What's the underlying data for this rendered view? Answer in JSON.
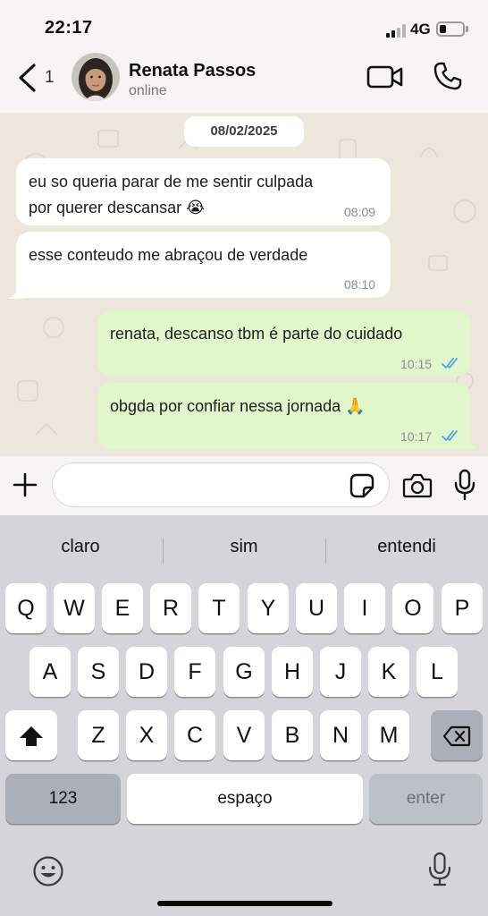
{
  "status_bar": {
    "time": "22:17",
    "network": "4G"
  },
  "header": {
    "unread_count": "1",
    "contact_name": "Renata Passos",
    "contact_status": "online"
  },
  "chat": {
    "date": "08/02/2025",
    "messages": [
      {
        "direction": "in",
        "lines": [
          "eu so queria parar de me sentir culpada",
          "por querer descansar 😭"
        ],
        "time": "08:09"
      },
      {
        "direction": "in",
        "lines": [
          "esse conteudo me abraçou de verdade"
        ],
        "time": "08:10"
      },
      {
        "direction": "out",
        "lines": [
          "renata, descanso tbm é parte do cuidado"
        ],
        "time": "10:15",
        "status": "read"
      },
      {
        "direction": "out",
        "lines": [
          "obgda por confiar nessa jornada 🙏"
        ],
        "time": "10:17",
        "status": "read"
      }
    ]
  },
  "composer": {
    "value": "",
    "placeholder": ""
  },
  "keyboard": {
    "suggestions": [
      "claro",
      "sim",
      "entendi"
    ],
    "row1": [
      "Q",
      "W",
      "E",
      "R",
      "T",
      "Y",
      "U",
      "I",
      "O",
      "P"
    ],
    "row2": [
      "A",
      "S",
      "D",
      "F",
      "G",
      "H",
      "J",
      "K",
      "L"
    ],
    "row3": [
      "Z",
      "X",
      "C",
      "V",
      "B",
      "N",
      "M"
    ],
    "numbers_key": "123",
    "space_key": "espaço",
    "enter_key": "enter"
  },
  "icons": {
    "back": "chevron-left-icon",
    "video": "video-camera-icon",
    "phone": "phone-icon",
    "plus": "plus-icon",
    "sticker": "sticker-icon",
    "camera": "camera-icon",
    "mic": "microphone-icon",
    "shift": "shift-icon",
    "backspace": "backspace-icon",
    "emoji": "emoji-icon",
    "dictation": "microphone-icon"
  },
  "colors": {
    "outgoing_bubble": "#e1f7cb",
    "incoming_bubble": "#ffffff",
    "chat_background": "#ece6dc",
    "read_ticks": "#4fa3e0",
    "keyboard_background": "#d3d5da"
  }
}
